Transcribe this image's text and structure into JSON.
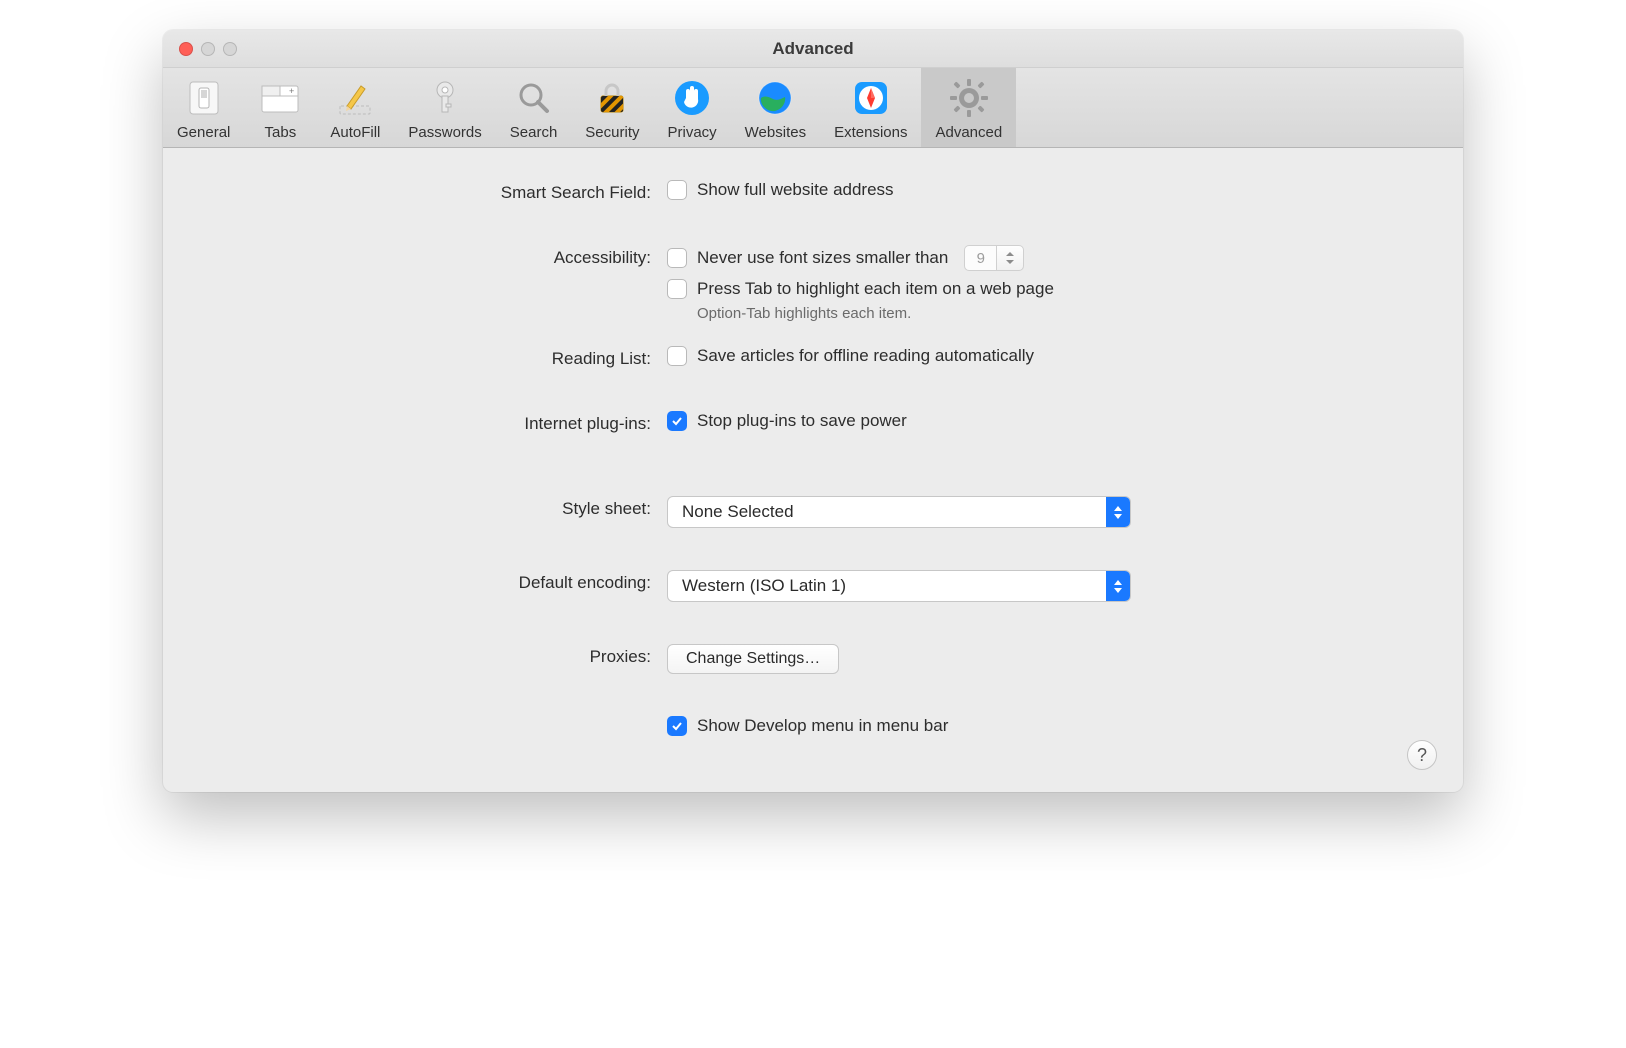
{
  "window": {
    "title": "Advanced"
  },
  "tabs": [
    {
      "label": "General"
    },
    {
      "label": "Tabs"
    },
    {
      "label": "AutoFill"
    },
    {
      "label": "Passwords"
    },
    {
      "label": "Search"
    },
    {
      "label": "Security"
    },
    {
      "label": "Privacy"
    },
    {
      "label": "Websites"
    },
    {
      "label": "Extensions"
    },
    {
      "label": "Advanced"
    }
  ],
  "sections": {
    "smart_search": {
      "label": "Smart Search Field:",
      "show_full_address": "Show full website address"
    },
    "accessibility": {
      "label": "Accessibility:",
      "never_use_font": "Never use font sizes smaller than",
      "font_size_value": "9",
      "press_tab": "Press Tab to highlight each item on a web page",
      "hint": "Option-Tab highlights each item."
    },
    "reading_list": {
      "label": "Reading List:",
      "save_offline": "Save articles for offline reading automatically"
    },
    "plugins": {
      "label": "Internet plug-ins:",
      "stop_plugins": "Stop plug-ins to save power"
    },
    "stylesheet": {
      "label": "Style sheet:",
      "value": "None Selected"
    },
    "encoding": {
      "label": "Default encoding:",
      "value": "Western (ISO Latin 1)"
    },
    "proxies": {
      "label": "Proxies:",
      "button": "Change Settings…"
    },
    "develop": {
      "label": "Show Develop menu in menu bar"
    }
  },
  "help": "?"
}
